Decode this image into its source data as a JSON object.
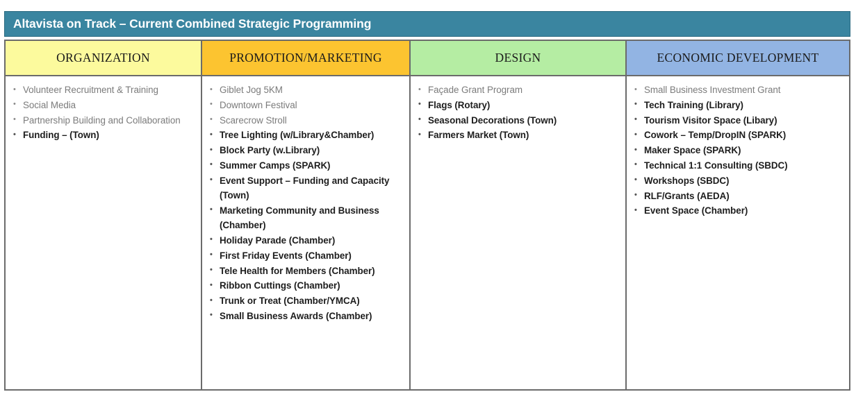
{
  "header": {
    "title": "Altavista on Track – Current Combined Strategic Programming",
    "bar_color": "#3a85a0",
    "title_color": "#ffffff"
  },
  "table": {
    "columns": [
      {
        "name": "organization",
        "header": "ORGANIZATION",
        "header_color": "#fcfa9d",
        "items": [
          {
            "text": "Volunteer Recruitment & Training",
            "bold": false
          },
          {
            "text": "Social Media",
            "bold": false
          },
          {
            "text": "Partnership Building and Collaboration",
            "bold": false
          },
          {
            "text": "Funding – (Town)",
            "bold": true
          }
        ]
      },
      {
        "name": "promotion-marketing",
        "header": "PROMOTION/MARKETING",
        "header_color": "#fcc430",
        "items": [
          {
            "text": "Giblet Jog 5KM",
            "bold": false
          },
          {
            "text": "Downtown Festival",
            "bold": false
          },
          {
            "text": "Scarecrow Stroll",
            "bold": false
          },
          {
            "text": "Tree Lighting (w/Library&Chamber)",
            "bold": true
          },
          {
            "text": "Block Party (w.Library)",
            "bold": true
          },
          {
            "text": "Summer Camps (SPARK)",
            "bold": true
          },
          {
            "text": "Event Support – Funding and Capacity (Town)",
            "bold": true
          },
          {
            "text": "Marketing Community and Business (Chamber)",
            "bold": true
          },
          {
            "text": "Holiday Parade (Chamber)",
            "bold": true
          },
          {
            "text": "First Friday Events (Chamber)",
            "bold": true
          },
          {
            "text": "Tele Health for Members (Chamber)",
            "bold": true
          },
          {
            "text": "Ribbon Cuttings (Chamber)",
            "bold": true
          },
          {
            "text": "Trunk or Treat (Chamber/YMCA)",
            "bold": true
          },
          {
            "text": "Small Business Awards (Chamber)",
            "bold": true
          }
        ]
      },
      {
        "name": "design",
        "header": "DESIGN",
        "header_color": "#b5eda3",
        "items": [
          {
            "text": "Façade Grant Program",
            "bold": false
          },
          {
            "text": "Flags (Rotary)",
            "bold": true
          },
          {
            "text": "Seasonal Decorations (Town)",
            "bold": true
          },
          {
            "text": "Farmers Market (Town)",
            "bold": true
          }
        ]
      },
      {
        "name": "economic-development",
        "header": "ECONOMIC DEVELOPMENT",
        "header_color": "#92b4e3",
        "items": [
          {
            "text": "Small Business Investment Grant",
            "bold": false
          },
          {
            "text": "Tech Training (Library)",
            "bold": true
          },
          {
            "text": "Tourism Visitor Space (Libary)",
            "bold": true
          },
          {
            "text": "Cowork – Temp/DropIN (SPARK)",
            "bold": true
          },
          {
            "text": "Maker Space (SPARK)",
            "bold": true
          },
          {
            "text": "Technical 1:1 Consulting (SBDC)",
            "bold": true
          },
          {
            "text": "Workshops (SBDC)",
            "bold": true
          },
          {
            "text": "RLF/Grants (AEDA)",
            "bold": true
          },
          {
            "text": "Event Space (Chamber)",
            "bold": true
          }
        ]
      }
    ]
  }
}
